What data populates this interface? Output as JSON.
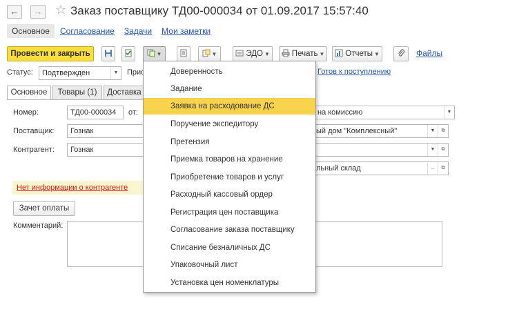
{
  "window": {
    "title": "Заказ поставщику ТД00-000034 от 01.09.2017 15:57:40"
  },
  "nav": {
    "back": "←",
    "forward": "→",
    "star": "☆",
    "tabs": [
      {
        "label": "Основное"
      },
      {
        "label": "Согласование"
      },
      {
        "label": "Задачи"
      },
      {
        "label": "Мои заметки"
      }
    ]
  },
  "toolbar": {
    "post_close_label": "Провести и закрыть",
    "edo_label": "ЭДО",
    "print_label": "Печать",
    "reports_label": "Отчеты",
    "files_label": "Файлы"
  },
  "status": {
    "label": "Статус:",
    "value": "Подтвержден",
    "priority_label": "Прио",
    "ready_link": "Готов к поступлению"
  },
  "form_tabs": [
    {
      "label": "Основное"
    },
    {
      "label": "Товары (1)"
    },
    {
      "label": "Доставка"
    }
  ],
  "form": {
    "number_label": "Номер:",
    "number_value": "ТД00-000034",
    "date_label": "от:",
    "supplier_label": "Поставщик:",
    "supplier_value": "Гознак",
    "contractor_label": "Контрагент:",
    "contractor_value": "Гознак",
    "operation_value": "на комиссию",
    "org_value": "ый дом \"Комплексный\"",
    "warehouse_value": "льный склад",
    "no_info_warning": "Нет информации о контрагенте",
    "payment_button": "Зачет оплаты",
    "comment_label": "Комментарий:"
  },
  "menu": {
    "items": [
      {
        "label": "Доверенность",
        "highlighted": false
      },
      {
        "label": "Задание",
        "highlighted": false
      },
      {
        "label": "Заявка на расходование ДС",
        "highlighted": true
      },
      {
        "label": "Поручение экспедитору",
        "highlighted": false
      },
      {
        "label": "Претензия",
        "highlighted": false
      },
      {
        "label": "Приемка товаров на хранение",
        "highlighted": false
      },
      {
        "label": "Приобретение товаров и услуг",
        "highlighted": false
      },
      {
        "label": "Расходный кассовый ордер",
        "highlighted": false
      },
      {
        "label": "Регистрация цен поставщика",
        "highlighted": false
      },
      {
        "label": "Согласование заказа поставщику",
        "highlighted": false
      },
      {
        "label": "Списание безналичных ДС",
        "highlighted": false
      },
      {
        "label": "Упаковочный лист",
        "highlighted": false
      },
      {
        "label": "Установка цен номенклатуры",
        "highlighted": false
      }
    ]
  },
  "colors": {
    "accent_yellow": "#f9dd3d",
    "menu_highlight": "#f9d24e",
    "link_blue": "#2255aa",
    "warning_red": "#e01010"
  }
}
